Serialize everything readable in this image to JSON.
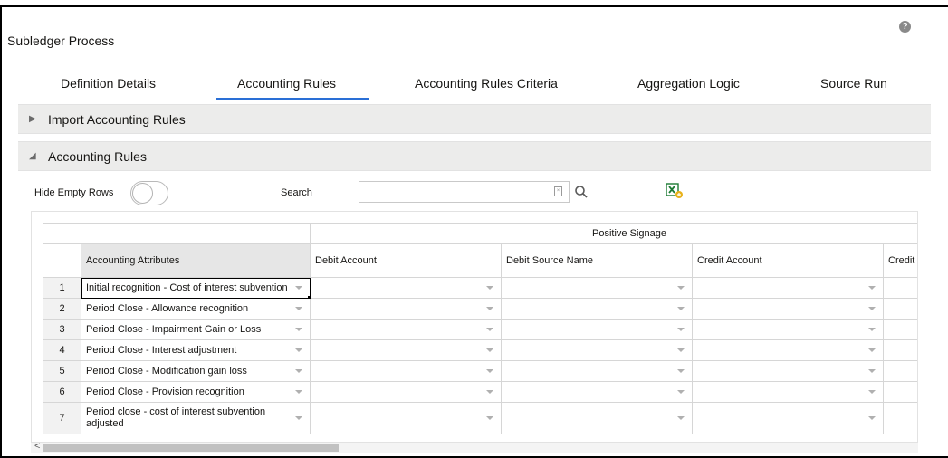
{
  "page": {
    "title": "Subledger Process",
    "help_icon": "question-circle-icon"
  },
  "tabs": [
    {
      "label": "Definition Details"
    },
    {
      "label": "Accounting Rules",
      "active": true
    },
    {
      "label": "Accounting Rules Criteria"
    },
    {
      "label": "Aggregation Logic"
    },
    {
      "label": "Source Run"
    }
  ],
  "sections": {
    "import": {
      "label": "Import Accounting Rules",
      "expanded": false
    },
    "rules": {
      "label": "Accounting Rules",
      "expanded": true
    }
  },
  "toolbar": {
    "hide_empty_rows_label": "Hide Empty Rows",
    "hide_empty_rows_on": false,
    "search_label": "Search",
    "search_value": "",
    "accent_color": "#2a6fd6"
  },
  "grid": {
    "group_header": "Positive Signage",
    "columns": [
      "Accounting Attributes",
      "Debit Account",
      "Debit Source Name",
      "Credit Account",
      "Credit S"
    ],
    "rows": [
      {
        "num": "1",
        "attr": "Initial recognition - Cost of interest subvention"
      },
      {
        "num": "2",
        "attr": "Period Close - Allowance recognition"
      },
      {
        "num": "3",
        "attr": "Period Close - Impairment Gain or Loss"
      },
      {
        "num": "4",
        "attr": "Period Close - Interest adjustment"
      },
      {
        "num": "5",
        "attr": "Period Close - Modification gain loss"
      },
      {
        "num": "6",
        "attr": "Period Close - Provision recognition"
      },
      {
        "num": "7",
        "attr": "Period close - cost of interest subvention adjusted"
      }
    ],
    "scroll_left_arrow": "<"
  }
}
